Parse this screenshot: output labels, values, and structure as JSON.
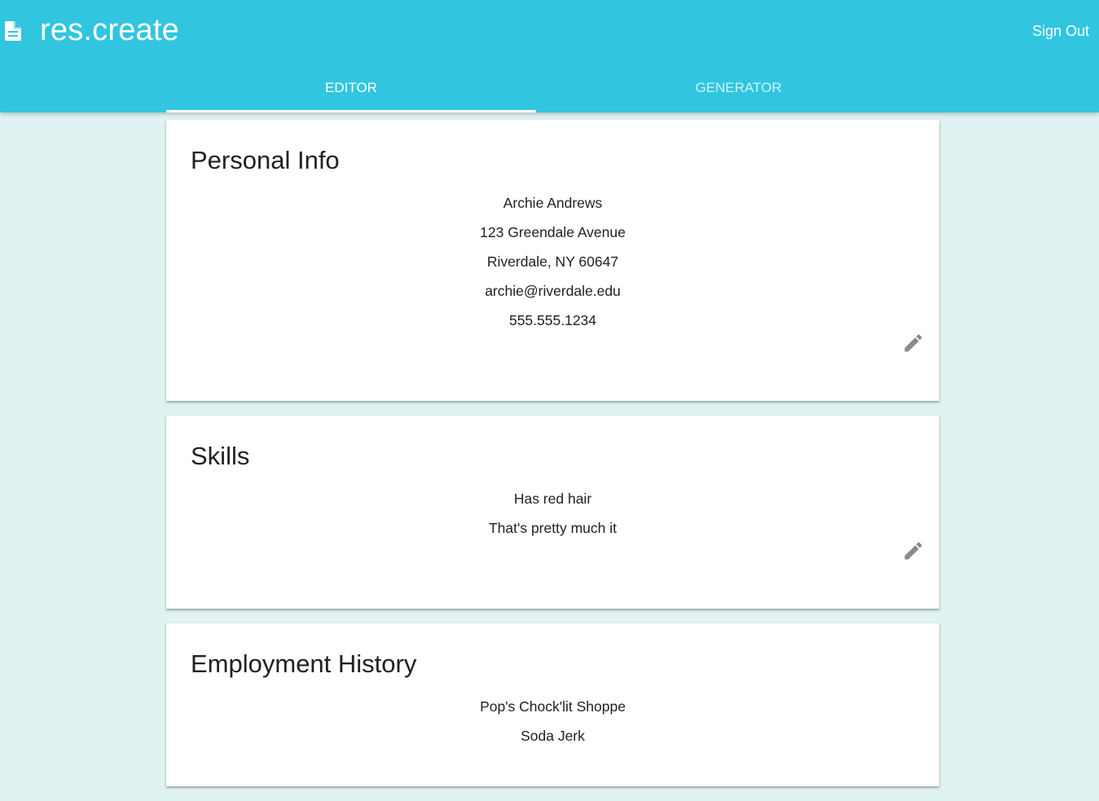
{
  "app": {
    "title": "res.create",
    "icon": "document-icon",
    "sign_out_label": "Sign Out"
  },
  "tabs": [
    {
      "label": "EDITOR",
      "active": true
    },
    {
      "label": "GENERATOR",
      "active": false
    }
  ],
  "cards": {
    "personal": {
      "title": "Personal Info",
      "lines": [
        "Archie Andrews",
        "123 Greendale Avenue",
        "Riverdale, NY 60647",
        "archie@riverdale.edu",
        "555.555.1234"
      ],
      "edit_icon": "pencil-icon"
    },
    "skills": {
      "title": "Skills",
      "lines": [
        "Has red hair",
        "That's pretty much it"
      ],
      "edit_icon": "pencil-icon"
    },
    "employment": {
      "title": "Employment History",
      "lines": [
        "Pop's Chock'lit Shoppe",
        "Soda Jerk"
      ]
    }
  },
  "colors": {
    "appbar": "#31c5e0",
    "background": "#e0f2f1",
    "text": "#212121",
    "icon": "#8a8a8a"
  }
}
